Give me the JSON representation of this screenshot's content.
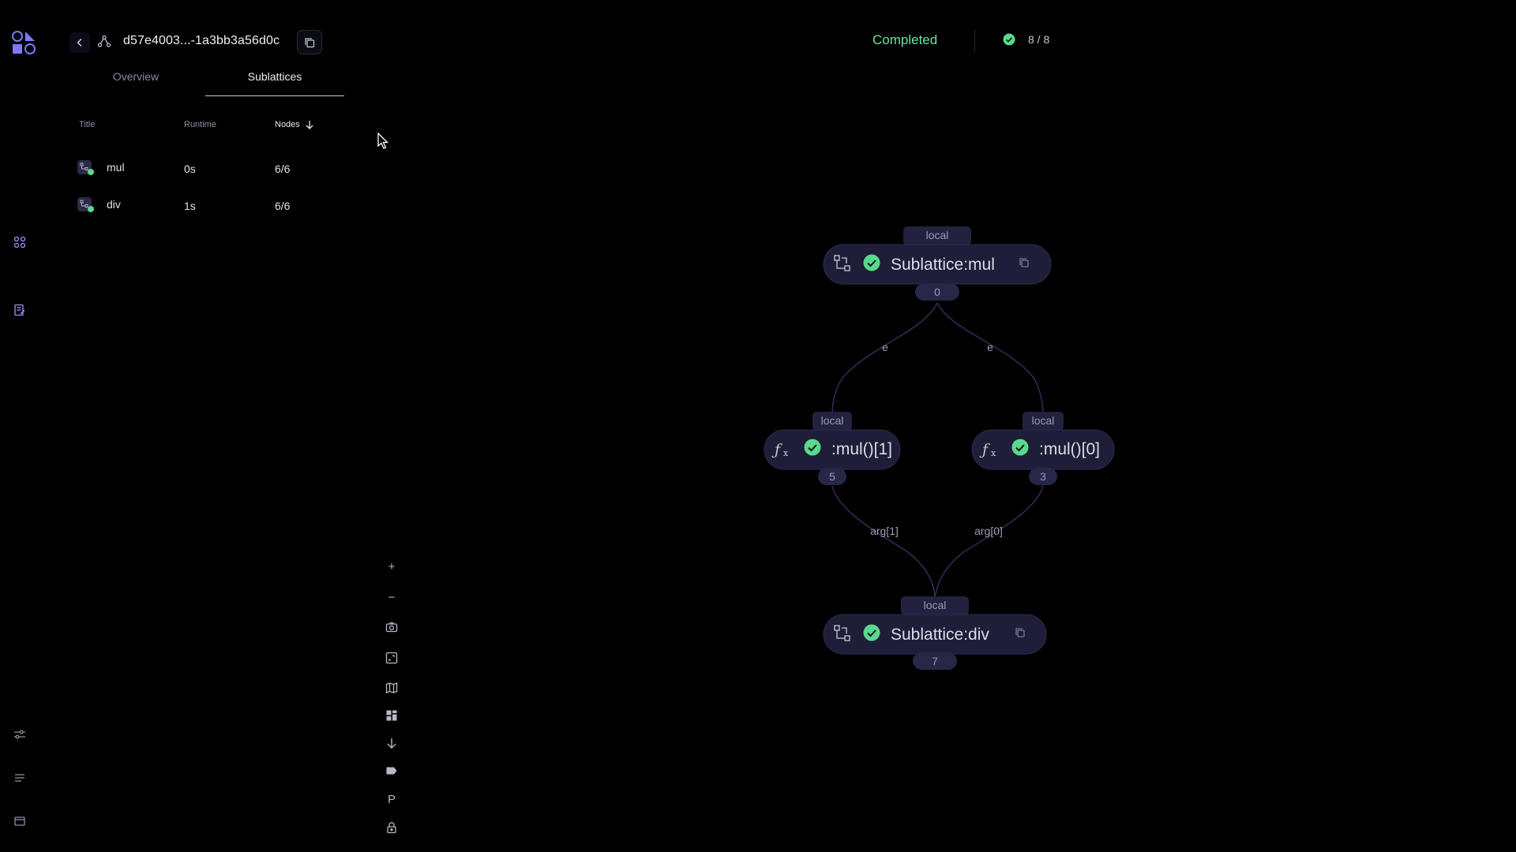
{
  "header": {
    "dispatch_id": "d57e4003...-1a3bb3a56d0c",
    "status": "Completed",
    "node_count": "8 / 8"
  },
  "tabs": [
    {
      "label": "Overview"
    },
    {
      "label": "Sublattices"
    }
  ],
  "table": {
    "columns": {
      "title": "Title",
      "runtime": "Runtime",
      "nodes": "Nodes"
    },
    "rows": [
      {
        "title": "mul",
        "runtime": "0s",
        "nodes": "6/6"
      },
      {
        "title": "div",
        "runtime": "1s",
        "nodes": "6/6"
      }
    ]
  },
  "controls": {
    "zoom_in": "+",
    "zoom_out": "−",
    "params": "P"
  },
  "graph": {
    "nodes": {
      "sub_mul": {
        "label": "Sublattice:mul",
        "executor": "local",
        "id": "0"
      },
      "mul1": {
        "label": ":mul()[1]",
        "executor": "local",
        "id": "5"
      },
      "mul0": {
        "label": ":mul()[0]",
        "executor": "local",
        "id": "3"
      },
      "sub_div": {
        "label": "Sublattice:div",
        "executor": "local",
        "id": "7"
      }
    },
    "edges": {
      "e_left": "e",
      "e_right": "e",
      "arg1": "arg[1]",
      "arg0": "arg[0]"
    }
  },
  "colors": {
    "background": "#000000",
    "node_fill": "#1f1f3a",
    "tag_fill": "#2a2a50",
    "edge": "#2e2e5a",
    "success": "#5ad88f",
    "brand": "#6f6cf0"
  }
}
